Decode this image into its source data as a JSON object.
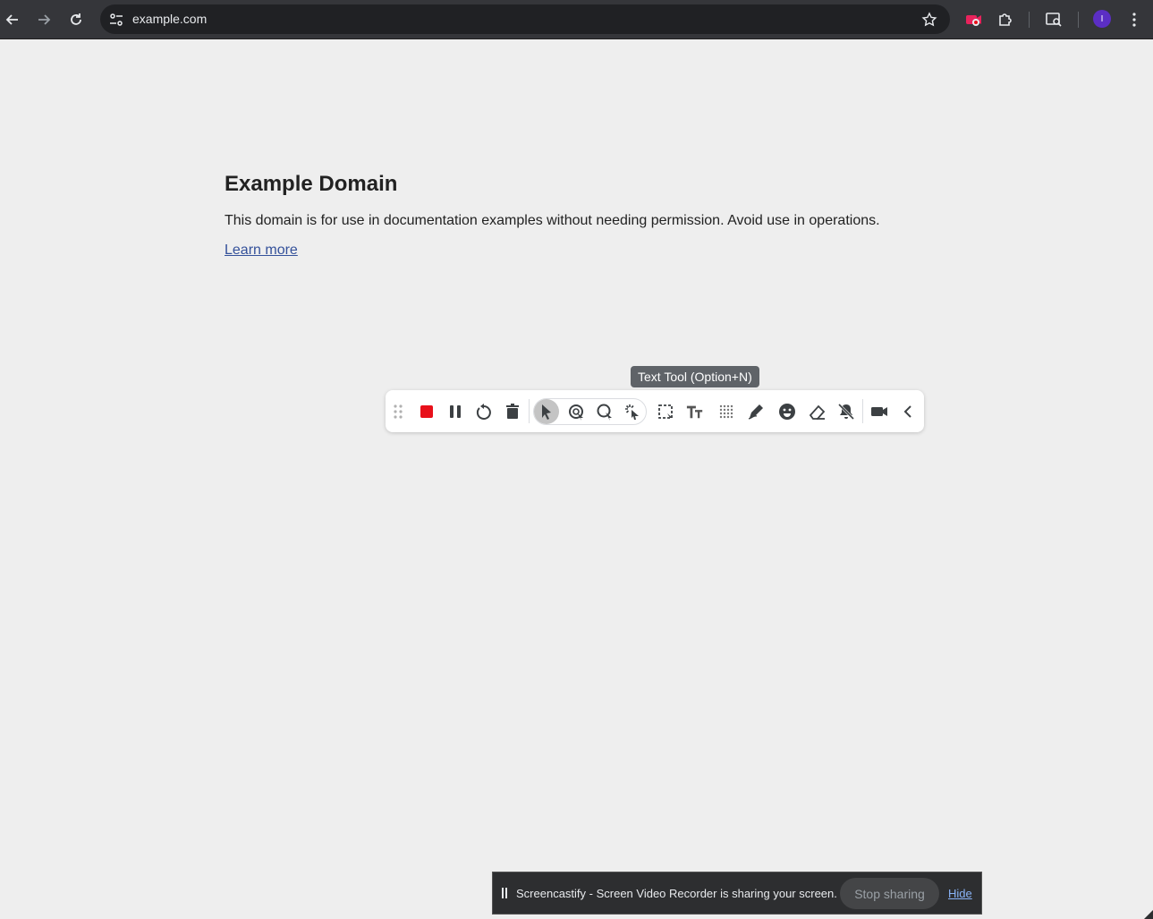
{
  "browser": {
    "url": "example.com",
    "avatar_initial": "I",
    "icons": [
      "back-icon",
      "forward-icon",
      "reload-icon",
      "site-settings-icon",
      "bookmark-star-icon",
      "screencastify-extension-icon",
      "extensions-puzzle-icon",
      "tab-search-icon",
      "avatar",
      "more-menu-icon"
    ]
  },
  "page": {
    "heading": "Example Domain",
    "paragraph": "This domain is for use in documentation examples without needing permission. Avoid use in operations.",
    "link": "Learn more"
  },
  "tooltip": {
    "text": "Text Tool (Option+N)"
  },
  "toolbar": {
    "accent_stop": "#e8101a",
    "tools": [
      "drag-handle",
      "stop-recording",
      "pause",
      "restart",
      "delete",
      "cursor",
      "click-highlight",
      "spotlight",
      "laser",
      "select-rect",
      "text-tool",
      "blur",
      "pen",
      "sticker",
      "eraser",
      "clear-annotations",
      "camera",
      "collapse"
    ]
  },
  "share_bar": {
    "message": "Screencastify - Screen Video Recorder is sharing your screen.",
    "stop_label": "Stop sharing",
    "hide_label": "Hide"
  }
}
